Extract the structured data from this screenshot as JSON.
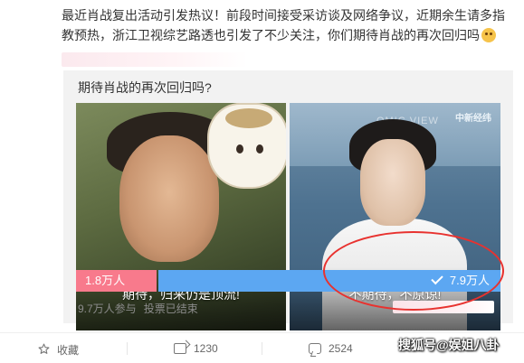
{
  "post": {
    "text": "最近肖战复出活动引发热议！前段时间接受采访谈及网络争议，近期余生请多指教预热，浙江卫视综艺路透也引发了不少关注，你们期待肖战的再次回归吗",
    "emoji_icon": "embarrassed-emoji"
  },
  "poll": {
    "title": "期待肖战的再次回归吗?",
    "options": [
      {
        "label": "期待，归来仍是顶流!",
        "votes": "1.8万人",
        "share": 0.19
      },
      {
        "label": "不期待，不原谅!",
        "votes": "7.9万人",
        "share": 0.81,
        "checked_icon": "check-icon"
      }
    ],
    "image_b_logo": "中新经纬",
    "image_b_watermark": "OMIC VIEW",
    "status_participants": "9.7万人参与",
    "status_ended": "投票已结束"
  },
  "actions": {
    "favorite": {
      "icon": "star-icon",
      "label": "收藏"
    },
    "share": {
      "icon": "share-icon",
      "count": "1230"
    },
    "comment": {
      "icon": "comment-icon",
      "count": "2524"
    }
  },
  "watermark": "搜狐号@娱姐八卦",
  "colors": {
    "left_bar": "#f87a8c",
    "right_bar": "#5ca7f2",
    "annotation_circle": "#e8322f"
  }
}
